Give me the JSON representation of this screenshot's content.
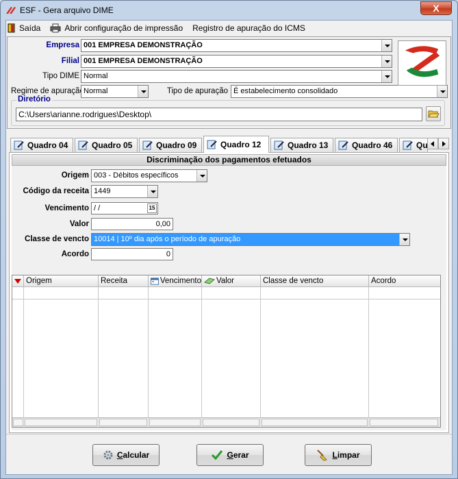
{
  "window": {
    "title": "ESF - Gera arquivo DIME",
    "close_label": "X"
  },
  "toolbar": {
    "exit_label": "Saída",
    "print_config_label": "Abrir configuração de impressão",
    "icms_label": "Registro de apuração do ICMS"
  },
  "form": {
    "empresa_label": "Empresa",
    "empresa_value": "001   EMPRESA DEMONSTRAÇÃO",
    "filial_label": "Filial",
    "filial_value": "001   EMPRESA DEMONSTRAÇÃO",
    "tipo_dime_label": "Tipo DIME",
    "tipo_dime_value": "Normal",
    "regime_label": "Regime de apuração",
    "regime_value": "Normal",
    "tipo_apuracao_label": "Tipo de apuração",
    "tipo_apuracao_value": "É estabelecimento consolidado",
    "diretorio_label": "Diretório",
    "diretorio_value": "C:\\Users\\arianne.rodrigues\\Desktop\\"
  },
  "tabs": [
    {
      "label": "Quadro 04"
    },
    {
      "label": "Quadro 05"
    },
    {
      "label": "Quadro 09"
    },
    {
      "label": "Quadro 12"
    },
    {
      "label": "Quadro 13"
    },
    {
      "label": "Quadro 46"
    },
    {
      "label": "Qua"
    }
  ],
  "active_tab": "Quadro 12",
  "section": {
    "title": "Discriminação dos pagamentos efetuados",
    "origem_label": "Origem",
    "origem_value": "003 - Débitos específicos",
    "codigo_label": "Código da receita",
    "codigo_value": "1449",
    "vencimento_label": "Vencimento",
    "vencimento_value": " /  /",
    "calendar_glyph": "15",
    "valor_label": "Valor",
    "valor_value": "0,00",
    "classe_label": "Classe de vencto",
    "classe_value": "10014 | 10º dia após o período de apuração",
    "acordo_label": "Acordo",
    "acordo_value": "0"
  },
  "grid": {
    "columns": [
      "Origem",
      "Receita",
      "Vencimento",
      "Valor",
      "Classe de vencto",
      "Acordo"
    ]
  },
  "buttons": {
    "calcular_u": "C",
    "calcular_rest": "alcular",
    "gerar_u": "G",
    "gerar_rest": "erar",
    "limpar_u": "L",
    "limpar_rest": "impar"
  },
  "colors": {
    "title_blue": "#00008b",
    "selection": "#3399ff",
    "close_red": "#c23a1c",
    "logo_red": "#d52b1e",
    "logo_green": "#1a8a3a"
  }
}
